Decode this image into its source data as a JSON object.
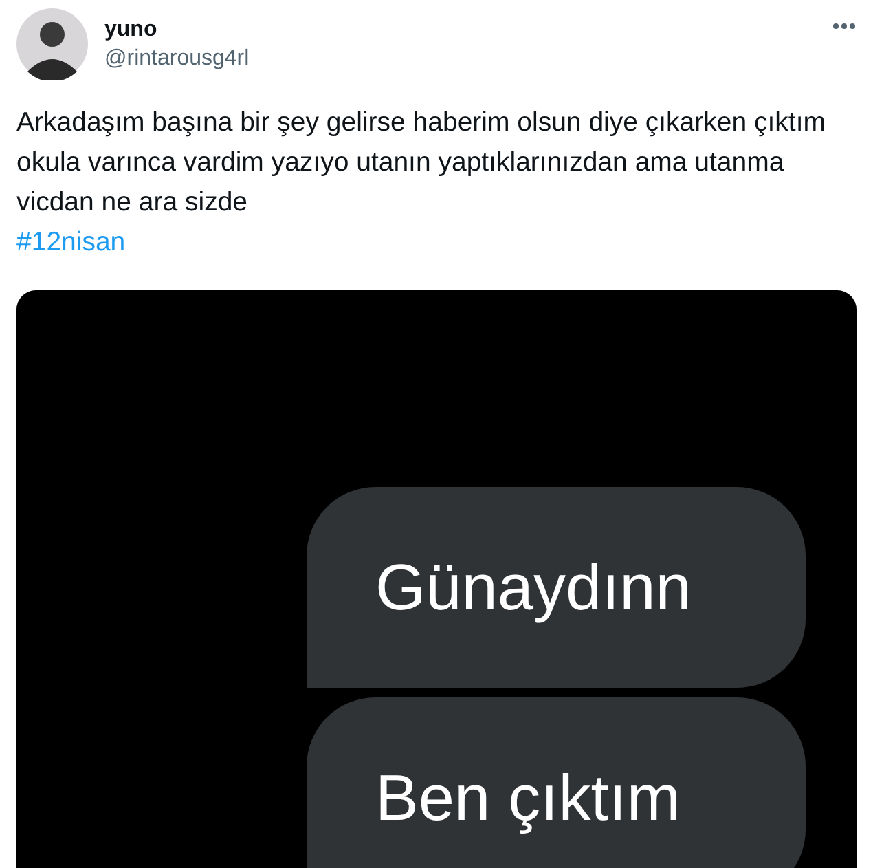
{
  "author": {
    "name": "yuno",
    "handle": "@rintarousg4rl"
  },
  "tweet": {
    "text": "Arkadaşım başına bir şey gelirse haberim olsun diye çıkarken çıktım okula varınca vardim yazıyo utanın yaptıklarınızdan ama utanma vicdan ne ara sizde",
    "hashtag": "#12nisan"
  },
  "media": {
    "messages": [
      {
        "text": "Günaydınn"
      },
      {
        "text": "Ben çıktım"
      }
    ]
  }
}
